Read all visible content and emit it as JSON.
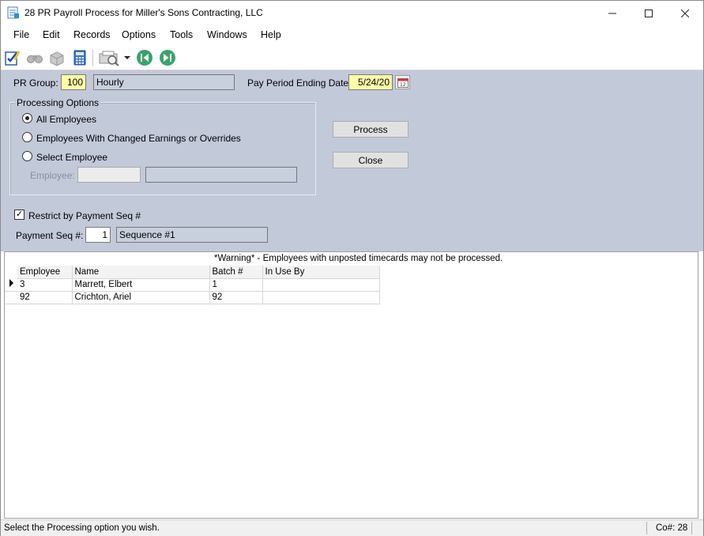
{
  "window": {
    "title": "28 PR Payroll Process for Miller's Sons Contracting, LLC"
  },
  "menu": [
    "File",
    "Edit",
    "Records",
    "Options",
    "Tools",
    "Windows",
    "Help"
  ],
  "toolbar": {
    "icons": [
      "checklist-edit-icon",
      "binoculars-icon",
      "box-icon",
      "calculator-icon",
      "print-preview-icon",
      "dropdown-arrow-icon",
      "first-record-icon",
      "last-record-icon"
    ]
  },
  "form": {
    "pr_group_label": "PR Group:",
    "pr_group_value": "100",
    "pr_group_desc": "Hourly",
    "pay_period_label": "Pay Period Ending Date:",
    "pay_period_value": "5/24/20",
    "processing_options_title": "Processing Options",
    "option_all": "All Employees",
    "option_changed": "Employees With Changed Earnings or Overrides",
    "option_select": "Select Employee",
    "employee_label": "Employee:",
    "employee_value": "",
    "employee_name": "",
    "selected_option": "All Employees",
    "process_button": "Process",
    "close_button": "Close",
    "restrict_label": "Restrict by Payment Seq #",
    "restrict_checked": "✓",
    "payment_seq_label": "Payment Seq #:",
    "payment_seq_value": "1",
    "payment_seq_desc": "Sequence #1"
  },
  "grid": {
    "warning": "*Warning* - Employees with unposted timecards may not be processed.",
    "columns": [
      "Employee",
      "Name",
      "Batch #",
      "In Use By"
    ],
    "rows": [
      {
        "employee": "3",
        "name": "Marrett, Elbert",
        "batch": "1",
        "in_use_by": ""
      },
      {
        "employee": "92",
        "name": "Crichton, Ariel",
        "batch": "92",
        "in_use_by": ""
      }
    ]
  },
  "status": {
    "message": "Select the Processing option you wish.",
    "company": "Co#: 28"
  }
}
